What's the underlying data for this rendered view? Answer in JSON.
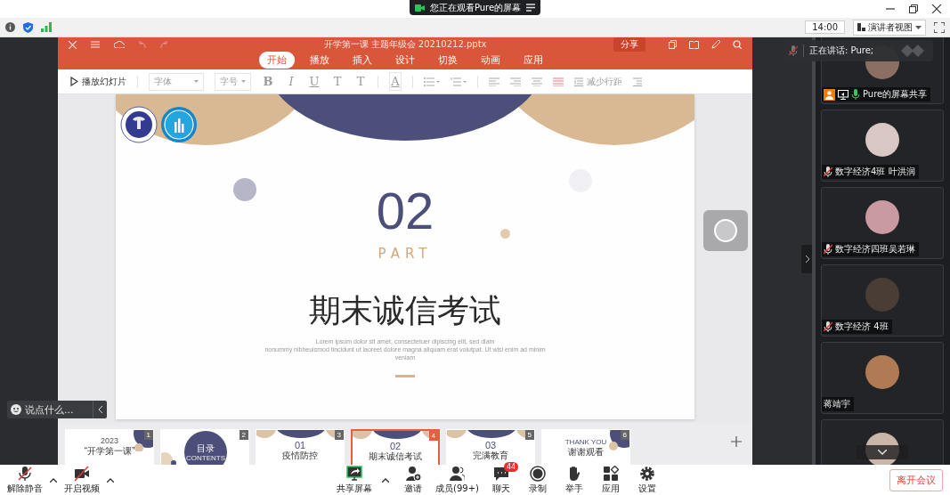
{
  "banner": {
    "text": "您正在观看Pure的屏幕"
  },
  "status_bar": {
    "time": "14:00",
    "view_menu": "演讲者视图"
  },
  "shared_screen": {
    "file_title": "开学第一课 主题年级会 20210212.pptx",
    "share_button": "分享",
    "tabs": [
      {
        "label": "开始",
        "selected": true
      },
      {
        "label": "播放",
        "selected": false
      },
      {
        "label": "插入",
        "selected": false
      },
      {
        "label": "设计",
        "selected": false
      },
      {
        "label": "切换",
        "selected": false
      },
      {
        "label": "动画",
        "selected": false
      },
      {
        "label": "应用",
        "selected": false
      }
    ],
    "toolbar": [
      {
        "kind": "play",
        "label": "播放幻灯片",
        "disabled": false
      },
      {
        "kind": "dropdown",
        "label": "字体",
        "disabled": true
      },
      {
        "kind": "dropdown",
        "label": "字号",
        "disabled": true
      },
      {
        "kind": "bold",
        "label": "B",
        "disabled": true
      },
      {
        "kind": "italic",
        "label": "I",
        "disabled": true
      },
      {
        "kind": "underline",
        "label": "U",
        "disabled": true
      },
      {
        "kind": "glyph",
        "label": "T",
        "disabled": true
      },
      {
        "kind": "glyph",
        "label": "T",
        "disabled": true
      },
      {
        "kind": "color",
        "label": "A",
        "disabled": true
      },
      {
        "kind": "spacing",
        "label": "减少行距",
        "disabled": true
      }
    ],
    "slide": {
      "number": "02",
      "part": "PART",
      "title": "期末诚信考试",
      "body_lines": [
        "Lorem ipsum dolor sit amet, consectetuer dipiscing elit, sed diam",
        "nonummy nibheuismod tincidunt ut laoreet dolore magna aliquam erat volutpat. Ut wisi enim ad minim",
        "veniam"
      ]
    },
    "thumbnails": [
      {
        "number": "1",
        "kind": "cover",
        "selected": false,
        "lines": [
          "2023",
          "“开学第一课”"
        ]
      },
      {
        "number": "2",
        "kind": "contents",
        "selected": false,
        "lines": [
          "目录",
          "CONTENTS"
        ]
      },
      {
        "number": "3",
        "kind": "section",
        "selected": false,
        "lines": [
          "01",
          "疫情防控"
        ]
      },
      {
        "number": "4",
        "kind": "section",
        "selected": true,
        "lines": [
          "02",
          "期末诚信考试"
        ]
      },
      {
        "number": "5",
        "kind": "section",
        "selected": false,
        "lines": [
          "03",
          "完满教育"
        ]
      },
      {
        "number": "6",
        "kind": "ending",
        "selected": false,
        "lines": [
          "THANK YOU",
          "谢谢观看"
        ]
      }
    ]
  },
  "chat_input": {
    "placeholder": "说点什么..."
  },
  "speaking": "正在讲话: Pure;",
  "participants": [
    {
      "name": "Pure的屏幕共享",
      "kind": "mic-on",
      "host": true,
      "sharing": true
    },
    {
      "name": "数字经济4班 叶洪润",
      "kind": "mic-muted",
      "host": false,
      "sharing": false
    },
    {
      "name": "数字经济四班吴若琳",
      "kind": "mic-muted",
      "host": false,
      "sharing": false
    },
    {
      "name": "数字经济 4班",
      "kind": "mic-muted",
      "host": false,
      "sharing": false
    },
    {
      "name": "蒋靖宇",
      "kind": "no-mic",
      "host": false,
      "sharing": false
    },
    {
      "kind": "no-mic",
      "host": false,
      "sharing": false
    }
  ],
  "toolbar": {
    "left": [
      {
        "kind": "mic-muted",
        "label": "解除静音",
        "menu": true
      },
      {
        "kind": "camera-off",
        "label": "开启视频",
        "menu": true
      }
    ],
    "center": [
      {
        "kind": "share",
        "label": "共享屏幕",
        "menu": true
      },
      {
        "kind": "invite",
        "label": "邀请",
        "menu": false
      },
      {
        "kind": "members",
        "label": "成员(99+)",
        "menu": false
      },
      {
        "kind": "chat",
        "label": "聊天",
        "menu": false,
        "badge": "44"
      },
      {
        "kind": "record",
        "label": "录制",
        "menu": false
      },
      {
        "kind": "hand",
        "label": "举手",
        "menu": false
      },
      {
        "kind": "apps",
        "label": "应用",
        "menu": false
      },
      {
        "kind": "settings",
        "label": "设置",
        "menu": false
      }
    ]
  },
  "leave_button": "离开会议"
}
